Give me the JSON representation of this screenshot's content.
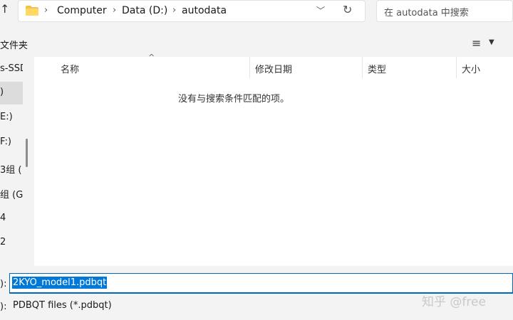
{
  "address": {
    "crumbs": [
      "Computer",
      "Data (D:)",
      "autodata"
    ],
    "search_placeholder": "在 autodata 中搜索"
  },
  "toolbar": {
    "new_folder": "文件夹"
  },
  "sidebar": {
    "items": [
      "s-SSD",
      ")",
      "E:)",
      "F:)",
      "3组 (",
      "组 (G",
      "4",
      "2"
    ]
  },
  "columns": {
    "name": "名称",
    "modified": "修改日期",
    "type": "类型",
    "size": "大小"
  },
  "empty_message": "没有与搜索条件匹配的项。",
  "bottom": {
    "filename_label": "):",
    "filename_value": "2KYO_model1.pdbqt",
    "filetype_label": "):",
    "filetype_value": "PDBQT files (*.pdbqt)"
  },
  "watermark": "知乎 @free"
}
